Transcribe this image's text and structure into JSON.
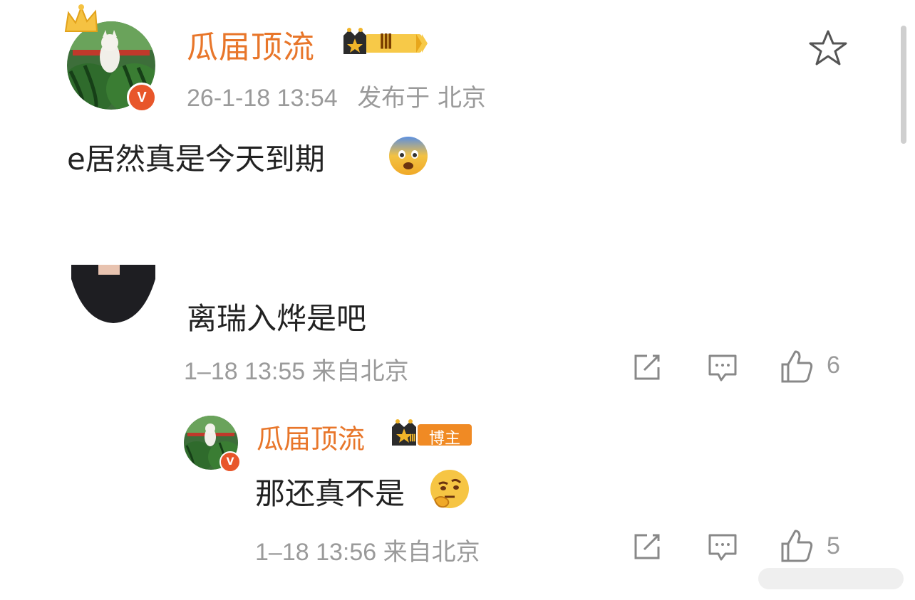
{
  "post": {
    "author": "瓜届顶流",
    "level_badge": "Ⅲ",
    "time": "26-1-18 13:54",
    "location": "发布于 北京",
    "text": "e居然真是今天到期",
    "verified_mark": "V"
  },
  "comments": [
    {
      "text": "离瑞入烨是吧",
      "meta": "1–18 13:55 来自北京",
      "likes": "6"
    }
  ],
  "reply": {
    "author": "瓜届顶流",
    "role_badge": "博主",
    "level_badge": "Ⅲ",
    "text": "那还真不是",
    "meta": "1–18 13:56 来自北京",
    "likes": "5",
    "verified_mark": "V"
  },
  "icons": {
    "favorite": "star-icon",
    "share": "edit-share-icon",
    "comment": "comment-icon",
    "like": "thumbs-up-icon"
  },
  "colors": {
    "username": "#e8762a",
    "verified": "#e8562a",
    "meta": "#9a9a9a"
  }
}
